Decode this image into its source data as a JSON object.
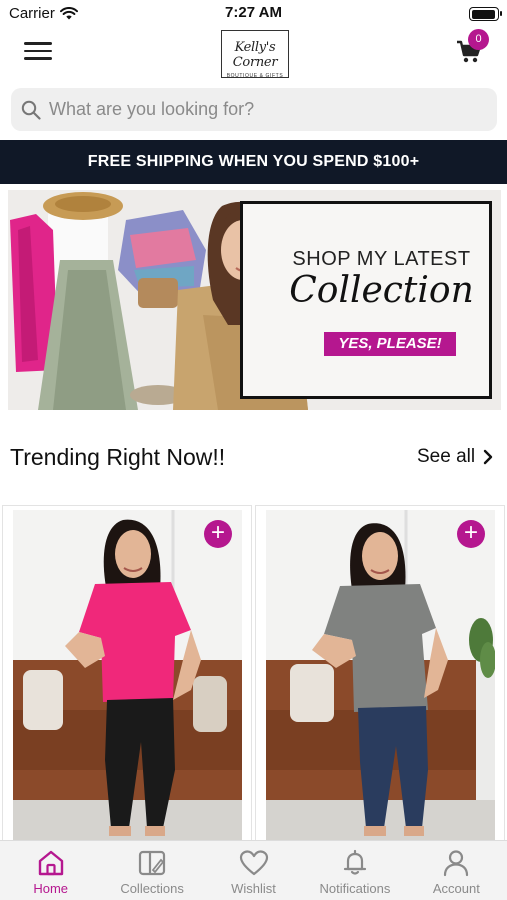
{
  "status_bar": {
    "carrier": "Carrier",
    "time": "7:27 AM"
  },
  "header": {
    "logo_main": "Kelly's Corner",
    "logo_sub": "BOUTIQUE & GIFTS",
    "cart_count": "0"
  },
  "search": {
    "placeholder": "What are you looking for?"
  },
  "promo": {
    "text": "FREE SHIPPING WHEN YOU SPEND $100+"
  },
  "banner": {
    "heading": "SHOP MY LATEST",
    "script": "Collection",
    "cta": "YES, PLEASE!"
  },
  "trending": {
    "title": "Trending Right Now!!",
    "see_all": "See all"
  },
  "products": [
    {
      "shirt_color": "#f0287a",
      "pants_color": "#1a1a1a"
    },
    {
      "shirt_color": "#808280",
      "pants_color": "#2a3c5e"
    }
  ],
  "tabs": [
    {
      "label": "Home",
      "icon": "home-icon",
      "active": true
    },
    {
      "label": "Collections",
      "icon": "collections-icon",
      "active": false
    },
    {
      "label": "Wishlist",
      "icon": "heart-icon",
      "active": false
    },
    {
      "label": "Notifications",
      "icon": "bell-icon",
      "active": false
    },
    {
      "label": "Account",
      "icon": "user-icon",
      "active": false
    }
  ],
  "colors": {
    "accent": "#b5178f",
    "promo_bg": "#101827",
    "tab_inactive": "#8a8a8a"
  }
}
